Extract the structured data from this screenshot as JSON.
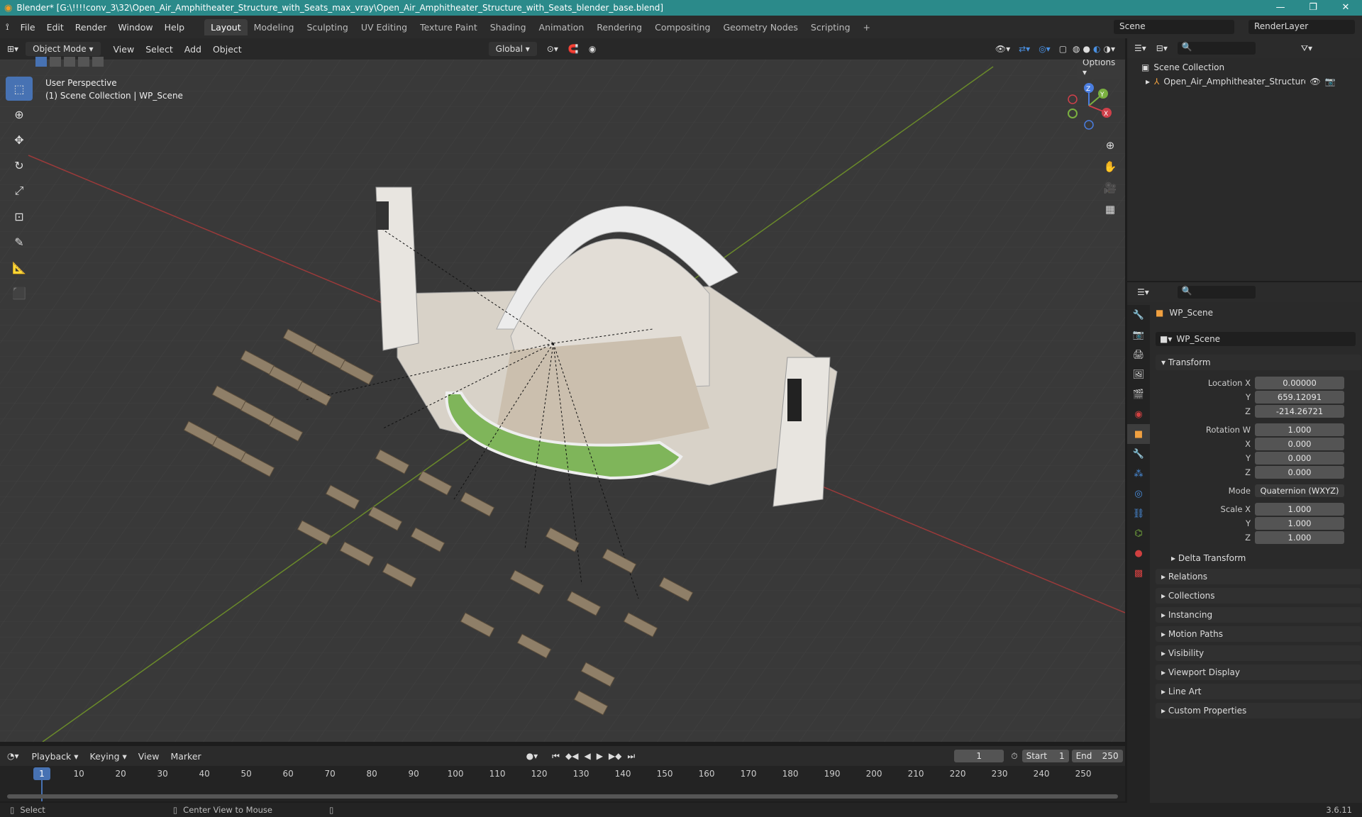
{
  "titlebar": {
    "title": "Blender* [G:\\!!!!conv_3\\32\\Open_Air_Amphitheater_Structure_with_Seats_max_vray\\Open_Air_Amphitheater_Structure_with_Seats_blender_base.blend]",
    "minimize": "—",
    "maximize": "❐",
    "close": "✕"
  },
  "menu": {
    "file": "File",
    "edit": "Edit",
    "render": "Render",
    "window": "Window",
    "help": "Help"
  },
  "workspaces": [
    "Layout",
    "Modeling",
    "Sculpting",
    "UV Editing",
    "Texture Paint",
    "Shading",
    "Animation",
    "Rendering",
    "Compositing",
    "Geometry Nodes",
    "Scripting",
    "+"
  ],
  "scene": {
    "name": "Scene",
    "render_layer": "RenderLayer"
  },
  "viewport_header": {
    "mode": "Object Mode",
    "view": "View",
    "select": "Select",
    "add": "Add",
    "object": "Object",
    "orientation": "Global",
    "options": "Options"
  },
  "viewport": {
    "perspective": "User Perspective",
    "collection": "(1) Scene Collection | WP_Scene"
  },
  "gizmo": {
    "z": "Z",
    "y": "Y",
    "x": "X"
  },
  "outliner": {
    "root": "Scene Collection",
    "item": "Open_Air_Amphitheater_Structure_with"
  },
  "properties": {
    "object_name": "WP_Scene",
    "data_name": "WP_Scene",
    "transform": "Transform",
    "location": {
      "label_x": "Location X",
      "label_y": "Y",
      "label_z": "Z",
      "x": "0.00000",
      "y": "659.12091",
      "z": "-214.26721"
    },
    "rotation": {
      "label_w": "Rotation W",
      "label_x": "X",
      "label_y": "Y",
      "label_z": "Z",
      "w": "1.000",
      "x": "0.000",
      "y": "0.000",
      "z": "0.000"
    },
    "mode_label": "Mode",
    "mode_value": "Quaternion (WXYZ)",
    "scale": {
      "label_x": "Scale X",
      "label_y": "Y",
      "label_z": "Z",
      "x": "1.000",
      "y": "1.000",
      "z": "1.000"
    },
    "delta": "Delta Transform",
    "panels": [
      "Relations",
      "Collections",
      "Instancing",
      "Motion Paths",
      "Visibility",
      "Viewport Display",
      "Line Art",
      "Custom Properties"
    ]
  },
  "timeline": {
    "playback": "Playback",
    "keying": "Keying",
    "view": "View",
    "marker": "Marker",
    "current_frame": "1",
    "start_label": "Start",
    "start": "1",
    "end_label": "End",
    "end": "250",
    "cursor_frame": "1",
    "ticks": [
      "10",
      "20",
      "30",
      "40",
      "50",
      "60",
      "70",
      "80",
      "90",
      "100",
      "110",
      "120",
      "130",
      "140",
      "150",
      "160",
      "170",
      "180",
      "190",
      "200",
      "210",
      "220",
      "230",
      "240",
      "250"
    ]
  },
  "status": {
    "select": "Select",
    "center": "Center View to Mouse",
    "version": "3.6.11"
  }
}
